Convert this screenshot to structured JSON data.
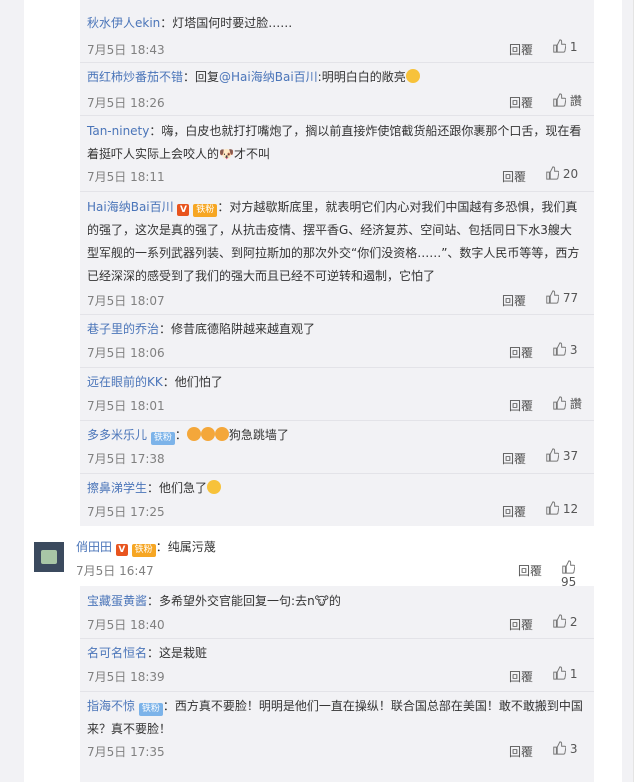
{
  "sub_replies_top": [
    {
      "user": "秋水伊人ekin",
      "sep": "：",
      "text": "灯塔国何时要过脸……",
      "time": "7月5日 18:43",
      "reply_label": "回覆",
      "likes": "1"
    },
    {
      "user": "西红柿炒番茄不错",
      "sep": "：回复",
      "mention": "@Hai海纳Bai百川",
      "text": ":明明白白的敞亮",
      "time": "7月5日 18:26",
      "reply_label": "回覆",
      "likes": "讚"
    },
    {
      "user": "Tan-ninety",
      "sep": "：",
      "text": "嗨，白皮也就打打嘴炮了，搁以前直接炸使馆截货船还跟你裹那个口舌，现在看着挺吓人实际上会咬人的🐶才不叫",
      "time": "7月5日 18:11",
      "reply_label": "回覆",
      "likes": "20"
    },
    {
      "user": "Hai海纳Bai百川",
      "badge_v": "V",
      "badge_fan": "铁粉",
      "sep": "：",
      "text": "对方越歇斯底里，就表明它们内心对我们中国越有多恐惧，我们真的强了，这次是真的强了，从抗击疫情、摆平香G、经济复苏、空间站、包括同日下水3艘大型军舰的一系列武器列装、到阿拉斯加的那次外交“你们没资格……”、数字人民币等等，西方已经深深的感受到了我们的强大而且已经不可逆转和遏制，它怕了",
      "time": "7月5日 18:07",
      "reply_label": "回覆",
      "likes": "77"
    },
    {
      "user": "巷子里的乔治",
      "sep": "：",
      "text": "修昔底德陷阱越来越直观了",
      "time": "7月5日 18:06",
      "reply_label": "回覆",
      "likes": "3"
    },
    {
      "user": "远在眼前的KK",
      "sep": "：",
      "text": "他们怕了",
      "time": "7月5日 18:01",
      "reply_label": "回覆",
      "likes": "讚"
    },
    {
      "user": "多多米乐儿",
      "badge_fan": "铁粉",
      "sep": "：",
      "text": "狗急跳墙了",
      "time": "7月5日 17:38",
      "reply_label": "回覆",
      "likes": "37"
    },
    {
      "user": "擦鼻涕学生",
      "sep": "：",
      "text": "他们急了",
      "time": "7月5日 17:25",
      "reply_label": "回覆",
      "likes": "12"
    }
  ],
  "main_comment": {
    "user": "俏田田",
    "badge_v": "V",
    "badge_fan": "铁粉",
    "sep": "：",
    "text": "纯属污蔑",
    "time": "7月5日 16:47",
    "reply_label": "回覆",
    "likes": "95"
  },
  "sub_replies_bottom": [
    {
      "user": "宝藏蛋黄酱",
      "sep": "：",
      "text": "多希望外交官能回复一句:去n🐮的",
      "time": "7月5日 18:40",
      "reply_label": "回覆",
      "likes": "2"
    },
    {
      "user": "名可名恒名",
      "sep": "：",
      "text": "这是栽赃",
      "time": "7月5日 18:39",
      "reply_label": "回覆",
      "likes": "1"
    },
    {
      "user": "指海不惊",
      "badge_fan": "铁粉",
      "sep": "：",
      "text": "西方真不要脸！明明是他们一直在操纵！联合国总部在美国！敢不敢搬到中国来？真不要脸！",
      "time": "7月5日 17:35",
      "reply_label": "回覆",
      "likes": "3"
    }
  ]
}
